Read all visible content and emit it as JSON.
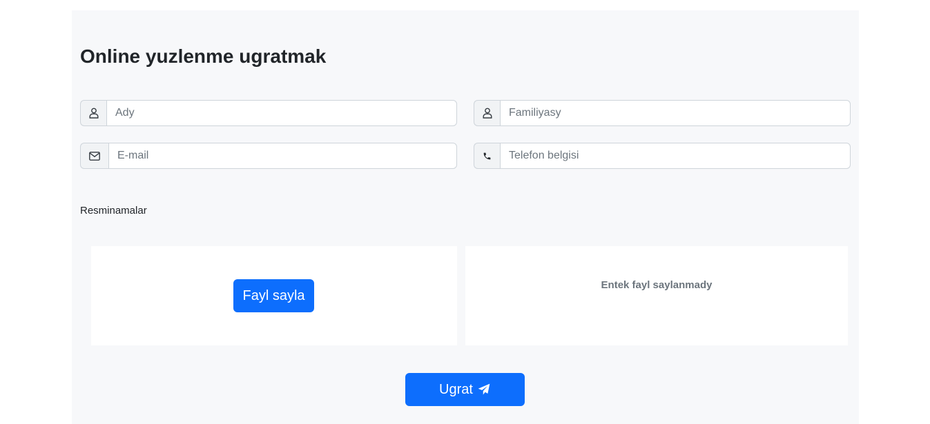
{
  "form": {
    "title": "Online yuzlenme ugratmak",
    "name_field": {
      "placeholder": "Ady",
      "icon": "user-icon"
    },
    "surname_field": {
      "placeholder": "Familiyasy",
      "icon": "user-icon"
    },
    "email_field": {
      "placeholder": "E-mail",
      "icon": "envelope-icon"
    },
    "phone_field": {
      "placeholder": "Telefon belgisi",
      "icon": "phone-icon"
    },
    "documents_label": "Resminamalar",
    "choose_file_label": "Fayl sayla",
    "no_file_text": "Entek fayl saylanmady",
    "submit_label": "Ugrat",
    "submit_icon": "paper-plane-icon"
  },
  "colors": {
    "panel_background": "#f7f8fa",
    "primary": "#0d6efd",
    "muted_text": "#6c757d"
  }
}
